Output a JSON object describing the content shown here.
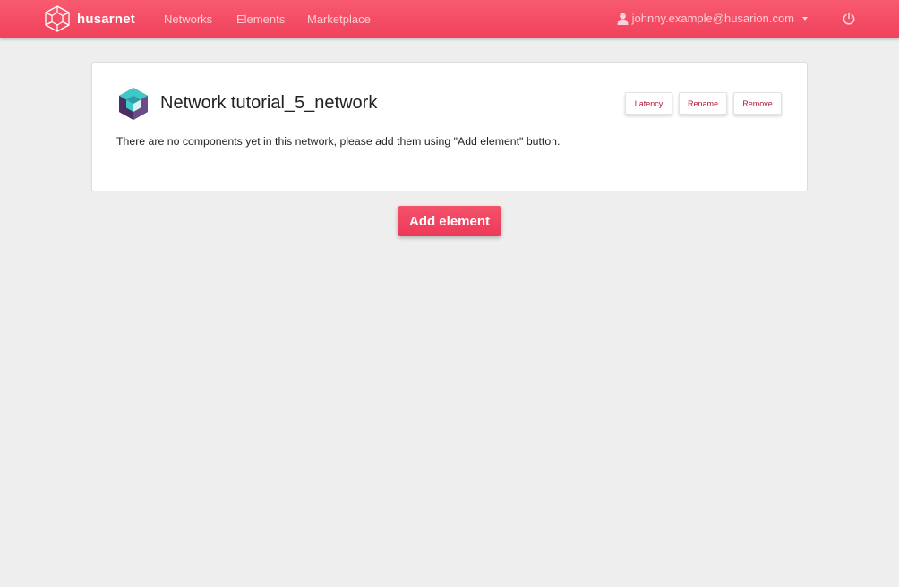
{
  "navbar": {
    "brand": "husarnet",
    "links": [
      "Networks",
      "Elements",
      "Marketplace"
    ],
    "user_email": "johnny.example@husarion.com",
    "icons": {
      "logo": "husarnet-cube-icon",
      "user": "user-icon",
      "power": "power-icon",
      "caret": "caret-down-icon"
    }
  },
  "network": {
    "title": "Network tutorial_5_network",
    "logo_icon": "network-hexagon-icon",
    "actions": {
      "latency": "Latency",
      "rename": "Rename",
      "remove": "Remove"
    },
    "empty_message": "There are no components yet in this network, please add them using \"Add element\" button."
  },
  "add_element_label": "Add element",
  "colors": {
    "navbar": "#f0415d",
    "accent": "#b0173a",
    "add_button": "#ec3a58",
    "background": "#eeeeee"
  }
}
